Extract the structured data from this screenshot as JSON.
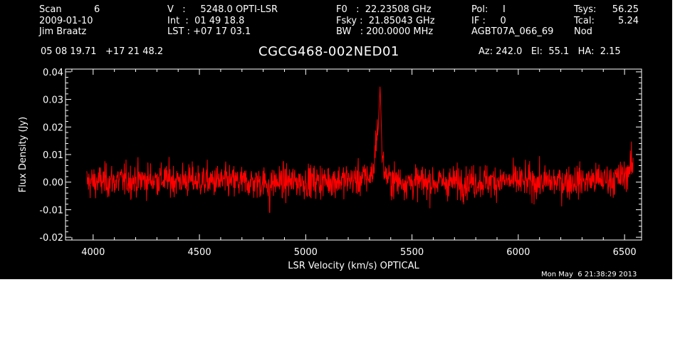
{
  "header": {
    "col1": [
      "Scan           6",
      "2009-01-10",
      "Jim Braatz"
    ],
    "col2": [
      "V   :     5248.0 OPTI-LSR",
      "Int  :  01 49 18.8",
      "LST : +07 17 03.1"
    ],
    "col3": [
      "F0   :  22.23508 GHz",
      "Fsky :  21.85043 GHz",
      "BW   : 200.0000 MHz"
    ],
    "col4": [
      "Pol:     I",
      "IF :     0",
      "AGBT07A_066_69"
    ],
    "col5a": [
      "Tsys:",
      "Tcal:",
      "Nod"
    ],
    "col5b": [
      "56.25",
      "5.24",
      ""
    ],
    "coords": "05 08 19.71   +17 21 48.2",
    "title": "CGCG468-002NED01",
    "az_el_ha": "Az: 242.0   El:  55.1   HA:  2.15",
    "timestamp": "Mon May  6 21:38:29 2013"
  },
  "colors": {
    "background": "#000000",
    "axes": "#ffffff",
    "trace": "#ff0000"
  },
  "chart_data": {
    "type": "line",
    "xlabel": "LSR Velocity (km/s) OPTICAL",
    "ylabel": "Flux Density (Jy)",
    "xlim": [
      3870,
      6580
    ],
    "ylim": [
      -0.021,
      0.041
    ],
    "xticks": [
      4000,
      4500,
      5000,
      5500,
      6000,
      6500
    ],
    "yticks": [
      -0.02,
      -0.01,
      0.0,
      0.01,
      0.02,
      0.03,
      0.04
    ],
    "ytick_labels": [
      "-0.02",
      "-0.01",
      "0.00",
      "0.01",
      "0.02",
      "0.03",
      "0.04"
    ],
    "noise_rms": 0.003,
    "series": [
      {
        "x": [
          3970,
          4100,
          4300,
          4500,
          4700,
          4900,
          5100,
          5250,
          5300,
          5320,
          5330,
          5340,
          5350,
          5360,
          5370,
          5390,
          5420,
          5500,
          5700,
          5900,
          6100,
          6300,
          6450,
          6500,
          6520,
          6540
        ],
        "values": [
          0.0,
          0.0005,
          0.001,
          0.0005,
          0.0,
          0.0,
          0.0005,
          0.001,
          0.002,
          0.004,
          0.016,
          0.018,
          0.035,
          0.009,
          0.004,
          0.001,
          0.0005,
          0.0,
          0.0,
          0.0005,
          0.0,
          0.0005,
          0.001,
          0.002,
          0.005,
          0.006
        ]
      }
    ],
    "grid": false
  }
}
